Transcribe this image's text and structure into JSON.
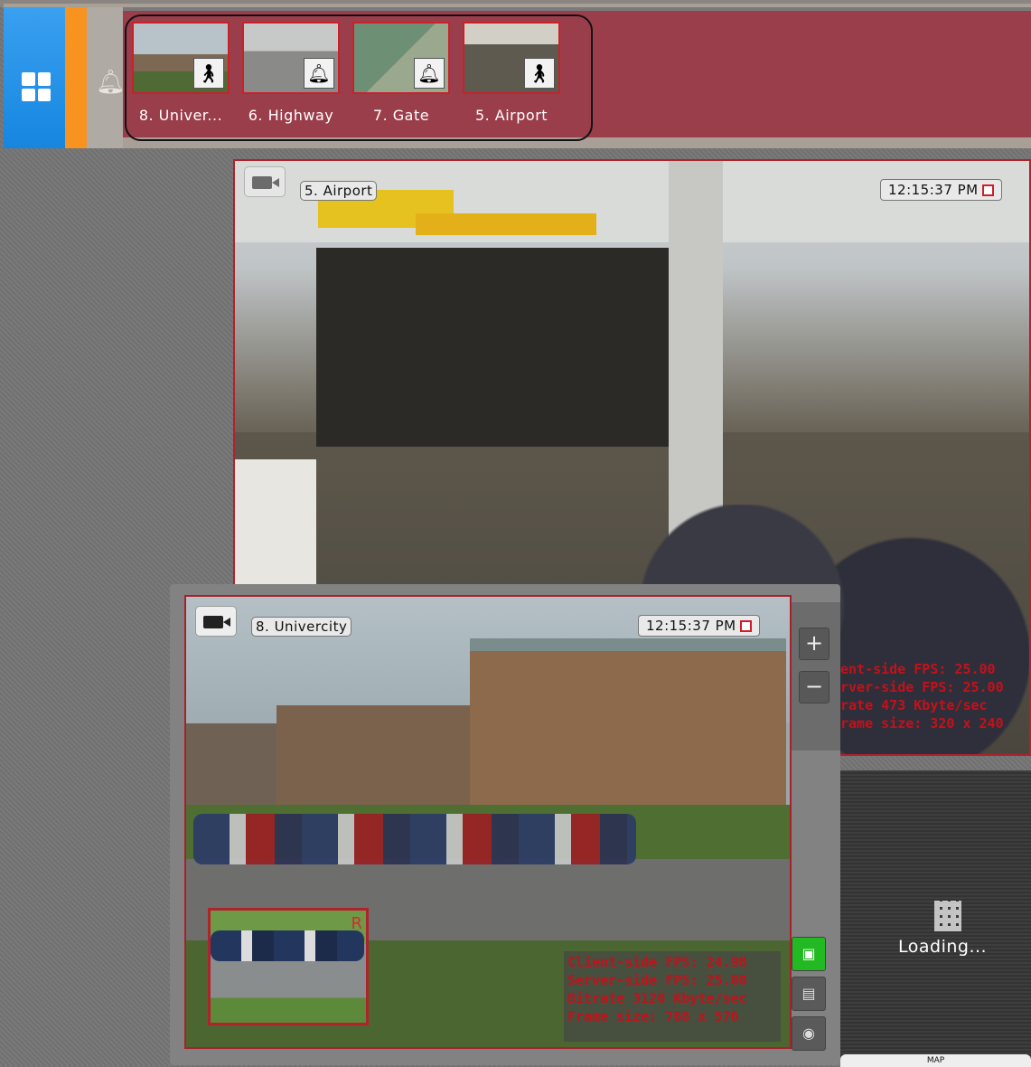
{
  "toolbar": {
    "home_icon": "windows-grid-icon",
    "bell_icon": "bell-icon",
    "accent_blue": "#1686e0",
    "accent_orange": "#f7931e"
  },
  "alarm_panel": {
    "color": "#9b3e4c",
    "thumbnails": [
      {
        "label": "8. Univer...",
        "icon": "person-walking-icon"
      },
      {
        "label": "6. Highway",
        "icon": "bell-hand-icon"
      },
      {
        "label": "7. Gate",
        "icon": "bell-hand-icon"
      },
      {
        "label": "5. Airport",
        "icon": "person-walking-icon"
      }
    ]
  },
  "camera_airport": {
    "title": "5. Airport",
    "timestamp": "12:15:37 PM",
    "stats": [
      "ent-side FPS: 25.00",
      "rver-side FPS: 25.00",
      "rate 473 Kbyte/sec",
      "rame size: 320 x 240"
    ]
  },
  "camera_university": {
    "title": "8. Univercity",
    "timestamp": "12:15:37 PM",
    "pip_label": "R",
    "stats": [
      "Client-side FPS: 24.98",
      "Server-side FPS: 25.00",
      "Bitrate 3120 Kbyte/sec",
      "Frame size: 768 x 576"
    ]
  },
  "zoom": {
    "in": "+",
    "out": "−"
  },
  "view_buttons": [
    {
      "name": "monitor-icon",
      "active": true
    },
    {
      "name": "archive-icon",
      "active": false
    },
    {
      "name": "eye-icon",
      "active": false
    }
  ],
  "loading_panel": {
    "text": "Loading..."
  },
  "map_tab": {
    "label": "MAP"
  }
}
